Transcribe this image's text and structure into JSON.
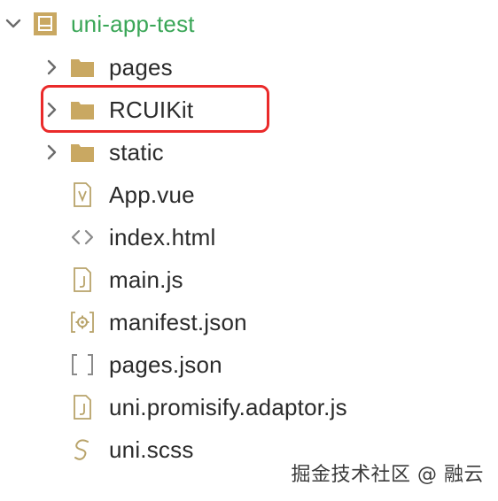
{
  "project": {
    "name": "uni-app-test",
    "expanded": true
  },
  "items": [
    {
      "label": "pages",
      "type": "folder"
    },
    {
      "label": "RCUIKit",
      "type": "folder"
    },
    {
      "label": "static",
      "type": "folder"
    },
    {
      "label": "App.vue",
      "type": "vue"
    },
    {
      "label": "index.html",
      "type": "html"
    },
    {
      "label": "main.js",
      "type": "js"
    },
    {
      "label": "manifest.json",
      "type": "manifest"
    },
    {
      "label": "pages.json",
      "type": "json"
    },
    {
      "label": "uni.promisify.adaptor.js",
      "type": "js"
    },
    {
      "label": "uni.scss",
      "type": "scss"
    }
  ],
  "highlight_target": "RCUIKit",
  "watermark": "掘金技术社区 @ 融云",
  "colors": {
    "root_label": "#3aa657",
    "folder": "#c9a862",
    "project_icon": "#c9a862",
    "highlight": "#ea2a2a",
    "file_icon": "#b8a36a",
    "chevron": "#6b6b6b"
  }
}
